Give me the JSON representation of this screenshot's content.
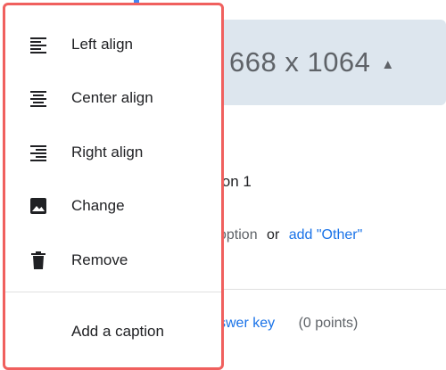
{
  "background": {
    "image_size": "668 x 1064",
    "option_text": "ion 1",
    "add_option_text": "option",
    "or_text": "or",
    "add_other_link": "add \"Other\"",
    "answer_key_link": "swer key",
    "points_text": "(0 points)",
    "accent_color": "#4285f4",
    "chip_color": "#dde6ee"
  },
  "menu": {
    "border_color": "#f0605e",
    "items": [
      {
        "label": "Left align",
        "icon": "left-align-icon"
      },
      {
        "label": "Center align",
        "icon": "center-align-icon"
      },
      {
        "label": "Right align",
        "icon": "right-align-icon"
      },
      {
        "label": "Change",
        "icon": "image-icon"
      },
      {
        "label": "Remove",
        "icon": "trash-icon"
      },
      {
        "label": "Add a caption",
        "icon": ""
      }
    ]
  }
}
